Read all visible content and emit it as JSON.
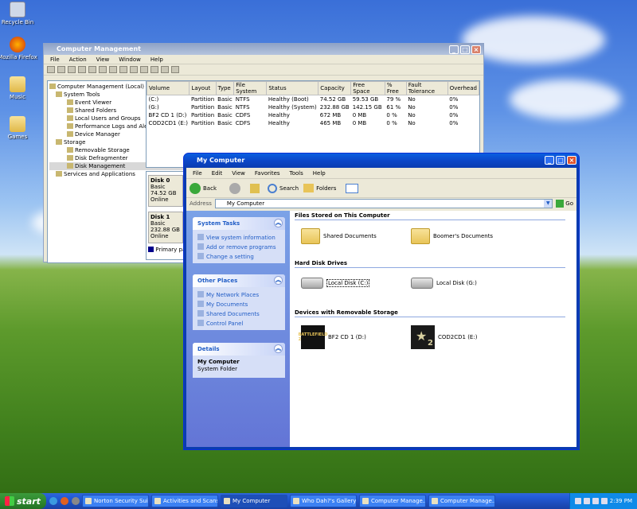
{
  "desktop": {
    "icons": [
      {
        "label": "Recycle Bin"
      },
      {
        "label": "Mozilla Firefox"
      },
      {
        "label": "Music"
      },
      {
        "label": "Games"
      }
    ]
  },
  "computer_management": {
    "title": "Computer Management",
    "menu": [
      "File",
      "Action",
      "View",
      "Window",
      "Help"
    ],
    "tree": [
      "Computer Management (Local)",
      "System Tools",
      "Event Viewer",
      "Shared Folders",
      "Local Users and Groups",
      "Performance Logs and Alert",
      "Device Manager",
      "Storage",
      "Removable Storage",
      "Disk Defragmenter",
      "Disk Management",
      "Services and Applications"
    ],
    "columns": [
      "Volume",
      "Layout",
      "Type",
      "File System",
      "Status",
      "Capacity",
      "Free Space",
      "% Free",
      "Fault Tolerance",
      "Overhead"
    ],
    "rows": [
      [
        "(C:)",
        "Partition",
        "Basic",
        "NTFS",
        "Healthy (Boot)",
        "74.52 GB",
        "59.53 GB",
        "79 %",
        "No",
        "0%"
      ],
      [
        "(G:)",
        "Partition",
        "Basic",
        "NTFS",
        "Healthy (System)",
        "232.88 GB",
        "142.15 GB",
        "61 %",
        "No",
        "0%"
      ],
      [
        "BF2 CD 1 (D:)",
        "Partition",
        "Basic",
        "CDFS",
        "Healthy",
        "672 MB",
        "0 MB",
        "0 %",
        "No",
        "0%"
      ],
      [
        "COD2CD1 (E:)",
        "Partition",
        "Basic",
        "CDFS",
        "Healthy",
        "465 MB",
        "0 MB",
        "0 %",
        "No",
        "0%"
      ]
    ],
    "disks": [
      {
        "name": "Disk 0",
        "type": "Basic",
        "size": "74.52 GB",
        "status": "Online"
      },
      {
        "name": "Disk 1",
        "type": "Basic",
        "size": "232.88 GB",
        "status": "Online"
      }
    ],
    "legend": "Primary par"
  },
  "my_computer": {
    "title": "My Computer",
    "menu": [
      "File",
      "Edit",
      "View",
      "Favorites",
      "Tools",
      "Help"
    ],
    "toolbar": {
      "back": "Back",
      "search": "Search",
      "folders": "Folders"
    },
    "address": {
      "label": "Address",
      "value": "My Computer",
      "go": "Go"
    },
    "system_tasks": {
      "title": "System Tasks",
      "items": [
        "View system information",
        "Add or remove programs",
        "Change a setting"
      ]
    },
    "other_places": {
      "title": "Other Places",
      "items": [
        "My Network Places",
        "My Documents",
        "Shared Documents",
        "Control Panel"
      ]
    },
    "details": {
      "title": "Details",
      "name": "My Computer",
      "desc": "System Folder"
    },
    "sections": {
      "files": "Files Stored on This Computer",
      "hdd": "Hard Disk Drives",
      "removable": "Devices with Removable Storage"
    },
    "items": {
      "shared_docs": "Shared Documents",
      "boomer_docs": "Boomer's Documents",
      "disk_c": "Local Disk (C:)",
      "disk_g": "Local Disk (G:)",
      "bf2": "BF2 CD 1 (D:)",
      "cod2": "COD2CD1 (E:)",
      "bf2_logo": "BATTLEFIELD 2",
      "cod2_logo": "2"
    }
  },
  "taskbar": {
    "start": "start",
    "tasks": [
      "Norton Security Suite",
      "Activities and Scans",
      "My Computer",
      "Who Dah?'s Gallery ...",
      "Computer Manage...",
      "Computer Manage..."
    ],
    "clock": "2:39 PM"
  }
}
